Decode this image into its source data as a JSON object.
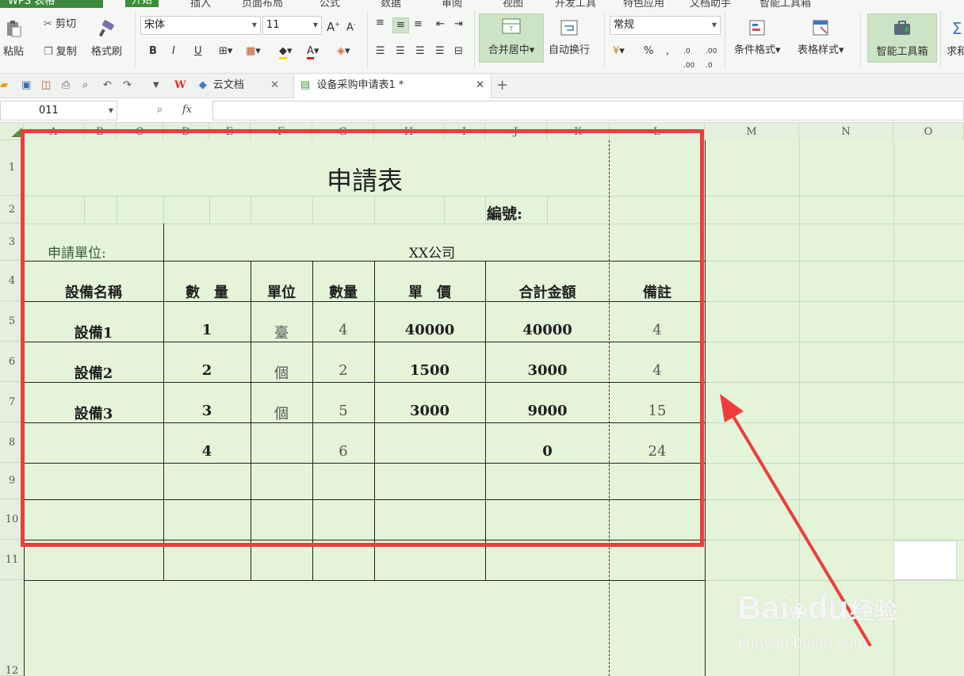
{
  "ribbon": {
    "app_button": "WPS 表格",
    "tabs": [
      "开始",
      "插入",
      "页面布局",
      "公式",
      "数据",
      "审阅",
      "视图",
      "开发工具",
      "特色应用",
      "文档助手",
      "智能工具箱"
    ],
    "paste_label": "粘贴",
    "cut_label": "剪切",
    "copy_label": "复制",
    "format_painter_label": "格式刷",
    "font_name": "宋体",
    "font_size": "11",
    "merge_center_label": "合并居中",
    "wrap_text_label": "自动换行",
    "number_format": "常规",
    "percent": "%",
    "comma": ",",
    "conditional_format_label": "条件格式",
    "table_style_label": "表格样式",
    "smart_toolbox_label": "智能工具箱",
    "sum_label": "求和"
  },
  "doc_tabs": {
    "wps_label": "W",
    "cloud_label": "云文档",
    "file_label": "设备采购申请表1 *",
    "add_label": "+"
  },
  "formula_bar": {
    "name_box": "011",
    "fx_label": "fx"
  },
  "columns": [
    "A",
    "B",
    "C",
    "D",
    "E",
    "F",
    "G",
    "H",
    "I",
    "J",
    "K",
    "L",
    "M",
    "N",
    "O"
  ],
  "rows": [
    "1",
    "2",
    "3",
    "4",
    "5",
    "6",
    "7",
    "8",
    "9",
    "10",
    "11",
    "12"
  ],
  "form": {
    "title": "申請表",
    "number_label": "編號:",
    "unit_label": "申請單位:",
    "unit_value": "XX公司",
    "headers": [
      "設備名稱",
      "數　量",
      "單位",
      "數量",
      "單　價",
      "合計金額",
      "備註"
    ],
    "rows": [
      [
        "設備1",
        "1",
        "臺",
        "4",
        "40000",
        "40000",
        "4"
      ],
      [
        "設備2",
        "2",
        "個",
        "2",
        "1500",
        "3000",
        "4"
      ],
      [
        "設備3",
        "3",
        "個",
        "5",
        "3000",
        "9000",
        "15"
      ],
      [
        "",
        "4",
        "",
        "6",
        "",
        "0",
        "24"
      ]
    ]
  },
  "watermark": {
    "brand": "Bai",
    "brand2": "du",
    "jingyan": "经验",
    "url": "jingyan.baidu.com"
  },
  "colors": {
    "sheet_bg": "#e3f4d9",
    "highlight_box": "#f03c3c",
    "arrow": "#f03c3c",
    "ribbon_active": "#3e8e3e"
  }
}
